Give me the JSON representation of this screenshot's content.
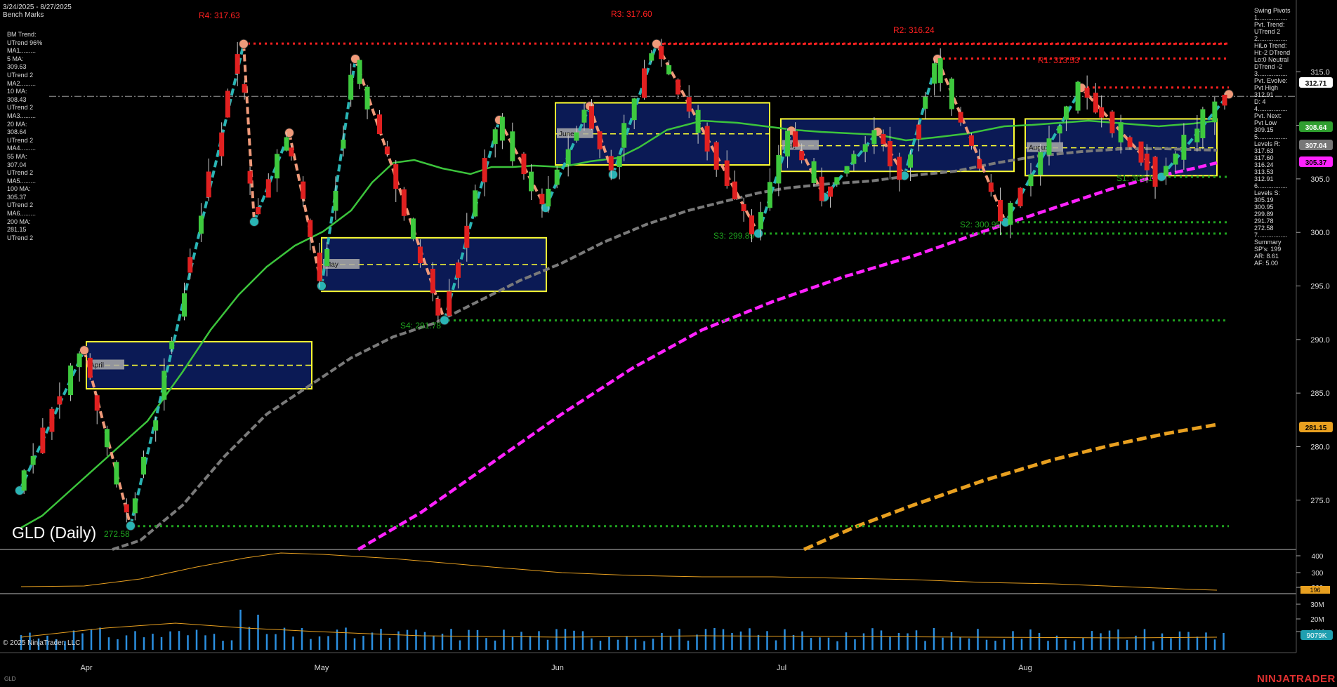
{
  "header": {
    "date_range": "3/24/2025 - 8/27/2025",
    "indicator_name": "Bench Marks"
  },
  "benchmarks_panel": [
    "BM Trend:",
    "UTrend 96%",
    "MA1.........",
    "5 MA:",
    "309.63",
    "UTrend 2",
    "MA2.........",
    "10 MA:",
    "308.43",
    "UTrend 2",
    "MA3.........",
    "20 MA:",
    "308.64",
    "UTrend 2",
    "MA4.........",
    "55 MA:",
    "307.04",
    "UTrend 2",
    "MA5.........",
    "100 MA:",
    "305.37",
    "UTrend 2",
    "MA6.........",
    "200 MA:",
    "281.15",
    "UTrend 2"
  ],
  "swing_panel": [
    "Swing Pivots",
    "1.................",
    "Pvt. Trend:",
    "UTrend 2",
    "2.................",
    "HiLo Trend:",
    "Hi:-2 DTrend",
    "Lo:0 Neutral",
    "DTrend -2",
    "3.................",
    "Pvt. Evolve:",
    "Pvt High",
    "312.91",
    "D: 4",
    "4.................",
    "Pvt. Next:",
    "Pvt Low",
    "309.15",
    "5.................",
    "Levels R:",
    "317.63",
    "317.60",
    "316.24",
    "313.53",
    "312.91",
    "6.................",
    "Levels S:",
    "305.19",
    "300.95",
    "299.89",
    "291.78",
    "272.58",
    "7.................",
    "Summary",
    "SP's: 199",
    "AR: 8.61",
    "AF: 5.00"
  ],
  "instrument_label": "GLD (Daily)",
  "copyright": "© 2025 NinjaTrader, LLC",
  "symbol": "GLD",
  "brand": "NINJATRADER",
  "colors": {
    "up_candle": "#3ec93e",
    "down_candle": "#e02020",
    "ma_green": "#3cc43c",
    "ma_gray": "#7a7a7a",
    "ma_magenta": "#ff22ff",
    "ma_orange": "#e8a020",
    "swing_up": "#2ab4b4",
    "swing_down": "#f09a7a",
    "resistance": "#ff2020",
    "support": "#1fa21f",
    "box_fill": "#0b1a55",
    "box_border": "#ffff33"
  },
  "resistance_labels": [
    {
      "text": "R4: 317.63",
      "value": 317.63
    },
    {
      "text": "R3: 317.60",
      "value": 317.6
    },
    {
      "text": "R2: 316.24",
      "value": 316.24
    },
    {
      "text": "R1: 313.53",
      "value": 313.53
    }
  ],
  "support_labels": [
    {
      "text": "S1: 305.19",
      "value": 305.19
    },
    {
      "text": "S2: 300.95",
      "value": 300.95
    },
    {
      "text": "S3: 299.89",
      "value": 299.89
    },
    {
      "text": "S4: 291.78",
      "value": 291.78
    },
    {
      "text": "272.58",
      "value": 272.58
    }
  ],
  "range_boxes": [
    {
      "label": "April"
    },
    {
      "label": "May"
    },
    {
      "label": "June"
    },
    {
      "label": "July"
    },
    {
      "label": "August"
    }
  ],
  "price_badges": [
    {
      "text": "312.71",
      "value": 312.71,
      "bg": "#ffffff",
      "fg": "#000000"
    },
    {
      "text": "308.64",
      "value": 308.64,
      "bg": "#2f9f2f",
      "fg": "#ffffff"
    },
    {
      "text": "307.04",
      "value": 307.04,
      "bg": "#777777",
      "fg": "#ffffff"
    },
    {
      "text": "305.37",
      "value": 305.37,
      "bg": "#ff22ff",
      "fg": "#000000"
    },
    {
      "text": "281.15",
      "value": 281.15,
      "bg": "#e8a020",
      "fg": "#000000"
    }
  ],
  "chart_data": {
    "type": "candlestick",
    "title": "GLD (Daily)",
    "x_axis_labels": [
      "Apr",
      "May",
      "Jun",
      "Jul",
      "Aug"
    ],
    "y_axis": {
      "ticks": [
        275.0,
        280.0,
        285.0,
        290.0,
        295.0,
        300.0,
        305.0,
        310.0,
        315.0
      ],
      "range": [
        270.4,
        321.7
      ]
    },
    "last_price": 312.71,
    "moving_averages": [
      {
        "name": "5 MA",
        "value": 309.63
      },
      {
        "name": "10 MA",
        "value": 308.43
      },
      {
        "name": "20 MA",
        "value": 308.64
      },
      {
        "name": "55 MA",
        "value": 307.04
      },
      {
        "name": "100 MA",
        "value": 305.37
      },
      {
        "name": "200 MA",
        "value": 281.15
      }
    ],
    "resistance_levels": [
      317.63,
      317.6,
      316.24,
      313.53,
      312.91
    ],
    "support_levels": [
      305.19,
      300.95,
      299.89,
      291.78,
      272.58
    ],
    "swing_points": [
      {
        "month": "Apr",
        "price": 275.9
      },
      {
        "month": "Apr",
        "price": 289.0
      },
      {
        "month": "Apr",
        "price": 272.6
      },
      {
        "month": "Apr",
        "price": 317.6
      },
      {
        "month": "Apr",
        "price": 301.0
      },
      {
        "month": "Apr",
        "price": 309.3
      },
      {
        "month": "May",
        "price": 295.0
      },
      {
        "month": "May",
        "price": 316.2
      },
      {
        "month": "May",
        "price": 291.8
      },
      {
        "month": "May",
        "price": 310.5
      },
      {
        "month": "Jun",
        "price": 302.3
      },
      {
        "month": "Jun",
        "price": 311.8
      },
      {
        "month": "Jun",
        "price": 305.4
      },
      {
        "month": "Jun",
        "price": 317.6
      },
      {
        "month": "Jun",
        "price": 299.9
      },
      {
        "month": "Jul",
        "price": 309.5
      },
      {
        "month": "Jul",
        "price": 303.3
      },
      {
        "month": "Jul",
        "price": 309.4
      },
      {
        "month": "Jul",
        "price": 305.3
      },
      {
        "month": "Jul",
        "price": 316.2
      },
      {
        "month": "Jul",
        "price": 300.95
      },
      {
        "month": "Aug",
        "price": 313.5
      },
      {
        "month": "Aug",
        "price": 305.2
      },
      {
        "month": "Aug",
        "price": 312.9
      }
    ],
    "range_boxes": [
      {
        "label": "April",
        "high": 289.8,
        "low": 285.4,
        "mid": 287.6
      },
      {
        "label": "May",
        "high": 299.5,
        "low": 294.5,
        "mid": 297.0
      },
      {
        "label": "June",
        "high": 312.1,
        "low": 306.3,
        "mid": 309.2
      },
      {
        "label": "July",
        "high": 310.6,
        "low": 305.7,
        "mid": 308.1
      },
      {
        "label": "August",
        "high": 310.6,
        "low": 305.3,
        "mid": 307.9
      }
    ],
    "panels": [
      {
        "name": "upper indicator",
        "ticks": [
          200,
          300,
          400
        ],
        "last": "196"
      },
      {
        "name": "volume",
        "ticks": [
          "10M",
          "20M",
          "30M"
        ],
        "last": "9079K"
      }
    ]
  }
}
